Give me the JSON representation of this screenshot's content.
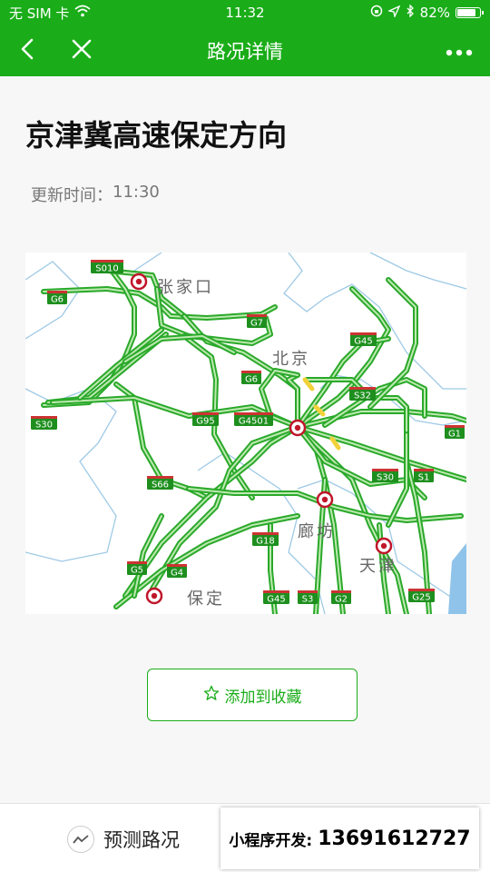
{
  "status": {
    "carrier": "无 SIM 卡",
    "time": "11:32",
    "battery": "82%",
    "battery_level": 0.82
  },
  "nav": {
    "title": "路况详情"
  },
  "route": {
    "title": "京津冀高速保定方向",
    "update_label": "更新时间：",
    "update_time": "11:30"
  },
  "map": {
    "cities": [
      "张家口",
      "北京",
      "廊坊",
      "天津",
      "保定"
    ],
    "highways": [
      "S010",
      "G6",
      "G7",
      "G45",
      "G6",
      "S32",
      "S30",
      "G95",
      "G4501",
      "G1",
      "S66",
      "S30",
      "S1",
      "G18",
      "G5",
      "G4",
      "G45",
      "S3",
      "G2",
      "G25"
    ],
    "colors": {
      "flow": "#2aa92a",
      "slow": "#f2d13a",
      "border": "#9ec9e5",
      "sign": "#1e8f1e"
    }
  },
  "actions": {
    "favorite": "添加到收藏",
    "predict": "预测路况"
  },
  "promo": {
    "label": "小程序开发:",
    "phone": "13691612727"
  },
  "theme": {
    "brand": "#1aad19"
  }
}
